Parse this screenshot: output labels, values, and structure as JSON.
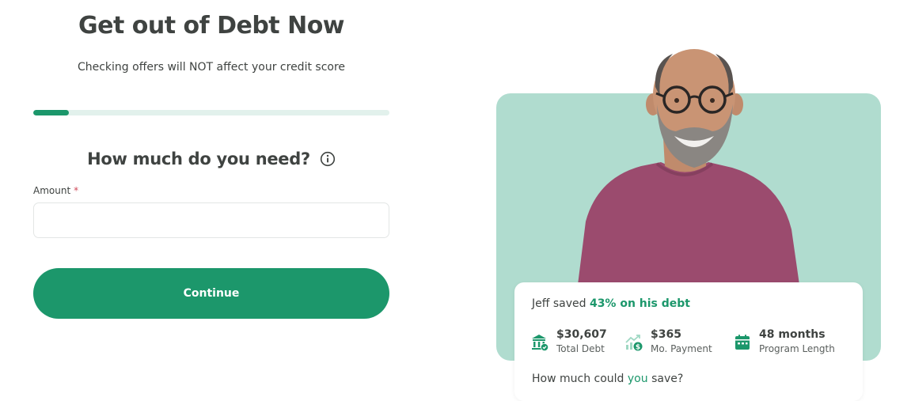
{
  "header": {
    "title": "Get out of Debt Now",
    "subtitle": "Checking offers will NOT affect your credit score"
  },
  "progress": {
    "fraction": 0.1,
    "color": "#1c976b"
  },
  "form": {
    "question": "How much do you need?",
    "info_icon": "info-circle-icon",
    "amount_label": "Amount",
    "required_mark": "*",
    "amount_value": "",
    "amount_placeholder": "",
    "continue_label": "Continue"
  },
  "testimonial": {
    "name_prefix": "Jeff saved",
    "saved_highlight": "43% on his debt",
    "stats": [
      {
        "icon": "bank-icon",
        "value": "$30,607",
        "caption": "Total Debt"
      },
      {
        "icon": "chart-dollar-icon",
        "value": "$365",
        "caption": "Mo. Payment"
      },
      {
        "icon": "calendar-icon",
        "value": "48 months",
        "caption": "Program Length"
      }
    ],
    "save_question_pre": "How much could",
    "save_question_accent": "you",
    "save_question_post": "save?"
  },
  "colors": {
    "brand": "#1c976b",
    "panel": "#b0dccf",
    "text": "#3f4341"
  }
}
